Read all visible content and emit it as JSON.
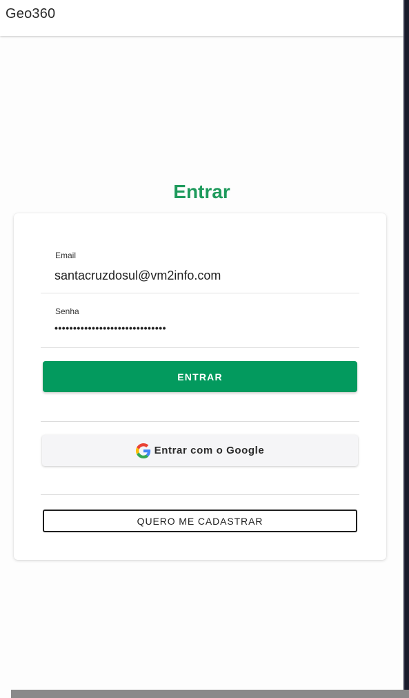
{
  "app_bar": {
    "title": "Geo360"
  },
  "heading": "Entrar",
  "form": {
    "email": {
      "label": "Email",
      "value": "santacruzdosul@vm2info.com"
    },
    "senha": {
      "label": "Senha",
      "value": "••••••••••••••••••••••••••••••"
    },
    "submit_label": "ENTRAR",
    "google_label": "Entrar com o Google",
    "register_label": "QUERO ME CADASTRAR"
  },
  "colors": {
    "accent": "#039a5e",
    "heading": "#1e9a5c"
  },
  "icons": {
    "google": "google-icon"
  }
}
